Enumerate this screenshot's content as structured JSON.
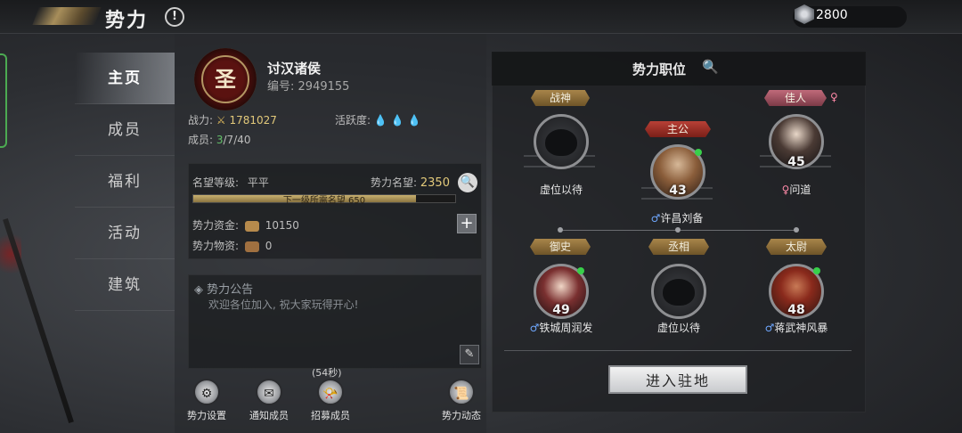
{
  "header": {
    "title": "势力",
    "help_icon": "!",
    "currency": {
      "icon": "silver-gem-icon",
      "value": "2800"
    }
  },
  "nav": {
    "items": [
      {
        "label": "主页",
        "active": true
      },
      {
        "label": "成员",
        "active": false
      },
      {
        "label": "福利",
        "active": false
      },
      {
        "label": "活动",
        "active": false
      },
      {
        "label": "建筑",
        "active": false
      }
    ]
  },
  "guild": {
    "emblem_char": "圣",
    "name": "讨汉诸侯",
    "id_label": "编号:",
    "id_value": "2949155",
    "power_label": "战力:",
    "power_value": "1781027",
    "activity_label": "活跃度:",
    "activity_flames": 3,
    "members_label": "成员:",
    "members_current": "3",
    "members_rest": "/7/40"
  },
  "reputation": {
    "level_label": "名望等级:",
    "level_value": "平平",
    "reputation_label": "势力名望:",
    "reputation_value": "2350",
    "progress_text": "下一级所需名望 650",
    "progress_fraction": 0.85,
    "funds_label": "势力资金:",
    "funds_value": "10150",
    "supplies_label": "势力物资:",
    "supplies_value": "0"
  },
  "notice": {
    "title": "◈ 势力公告",
    "body": "欢迎各位加入, 祝大家玩得开心!"
  },
  "actions": {
    "settings": "势力设置",
    "notify": "通知成员",
    "recruit": "招募成员",
    "recruit_timer": "(54秒)",
    "news": "势力动态"
  },
  "positions": {
    "title": "势力职位",
    "seats": [
      {
        "role": "战神",
        "name": "虚位以待",
        "level": ""
      },
      {
        "role": "主公",
        "name": "许昌刘备",
        "gender": "♂",
        "level": "43"
      },
      {
        "role": "佳人",
        "role_suffix": "♀",
        "name": "问道",
        "gender": "♀",
        "level": "45"
      },
      {
        "role": "御史",
        "name": "铁城周润发",
        "gender": "♂",
        "level": "49"
      },
      {
        "role": "丞相",
        "name": "虚位以待",
        "level": ""
      },
      {
        "role": "太尉",
        "name": "蒋武神风暴",
        "gender": "♂",
        "level": "48"
      }
    ],
    "enter_button": "进入驻地"
  }
}
